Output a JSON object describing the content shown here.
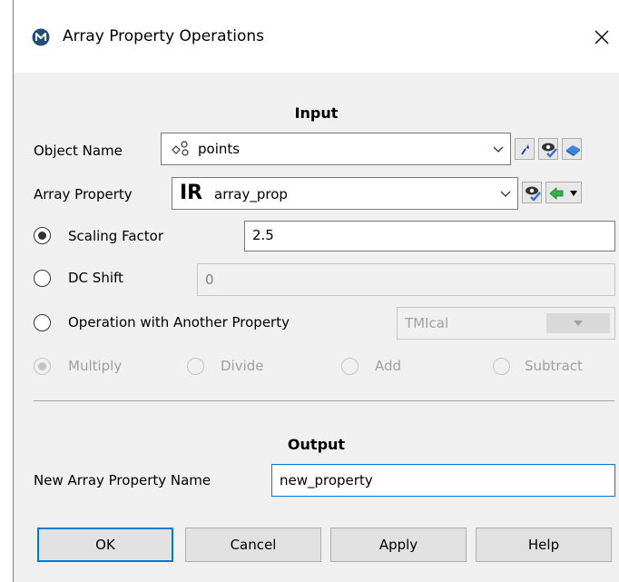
{
  "window": {
    "title": "Array Property Operations",
    "app_icon": "m-logo-icon",
    "close_icon": "close-icon"
  },
  "input": {
    "heading": "Input",
    "object_name": {
      "label": "Object Name",
      "icon": "point-set-icon",
      "value": "points"
    },
    "array_property": {
      "label": "Array Property",
      "type_prefix": "IR",
      "value": "array_prop"
    },
    "scaling_factor": {
      "label": "Scaling Factor",
      "value": "2.5",
      "selected": true
    },
    "dc_shift": {
      "label": "DC Shift",
      "value": "0",
      "selected": false
    },
    "operation": {
      "label": "Operation with Another Property",
      "value": "TMIcal",
      "selected": false,
      "ops": [
        {
          "label": "Multiply",
          "selected": true
        },
        {
          "label": "Divide",
          "selected": false
        },
        {
          "label": "Add",
          "selected": false
        },
        {
          "label": "Subtract",
          "selected": false
        }
      ]
    }
  },
  "output": {
    "heading": "Output",
    "new_name_label": "New Array Property Name",
    "new_name_value": "new_property"
  },
  "buttons": {
    "ok": "OK",
    "cancel": "Cancel",
    "apply": "Apply",
    "help": "Help"
  },
  "colors": {
    "accent": "#0078d7",
    "background": "#f0f0f0"
  }
}
